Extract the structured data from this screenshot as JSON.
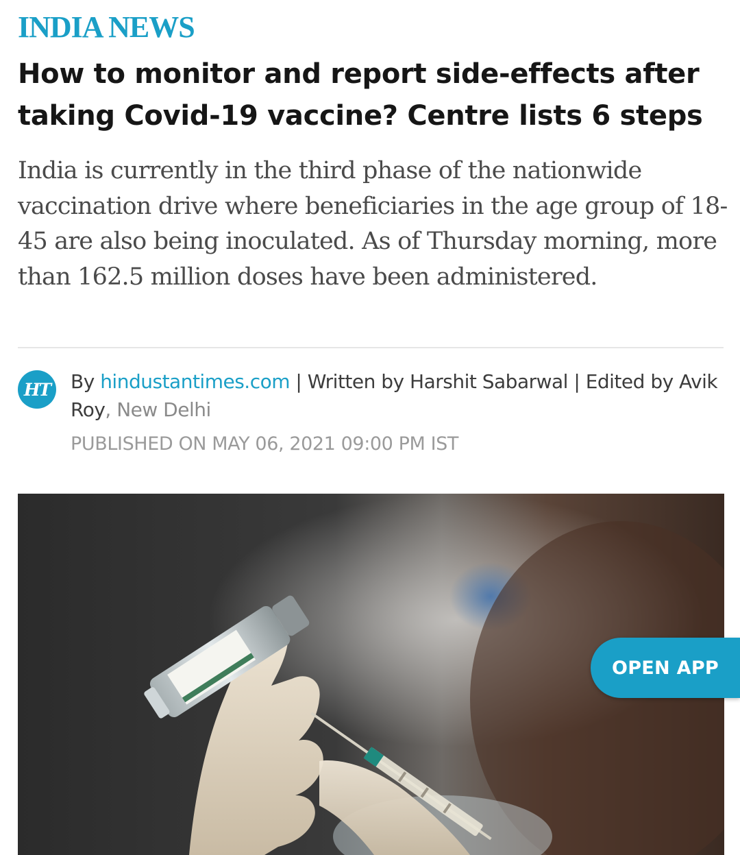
{
  "section": {
    "label": "INDIA NEWS"
  },
  "article": {
    "headline": "How to monitor and report side-effects after taking Covid-19 vaccine? Centre lists 6 steps",
    "summary": "India is currently in the third phase of the nationwide vaccination drive where beneficiaries in the age group of 18-45 are also being inoculated. As of Thursday morning, more than 162.5 million doses have been administered.",
    "byline": {
      "prefix": "By ",
      "source": "hindustantimes.com",
      "written_by": " | Written by Harshit Sabarwal | Edited by Avik Roy",
      "location": ", New Delhi"
    },
    "published": "PUBLISHED ON MAY 06, 2021 09:00 PM IST"
  },
  "source_logo": {
    "text": "HT",
    "icon": "hindustan-times-logo"
  },
  "floating_button": {
    "label": "OPEN APP"
  },
  "colors": {
    "accent": "#1a9fc7",
    "headline": "#161616",
    "summary": "#4a4a4a",
    "meta": "#9a9a9a"
  }
}
